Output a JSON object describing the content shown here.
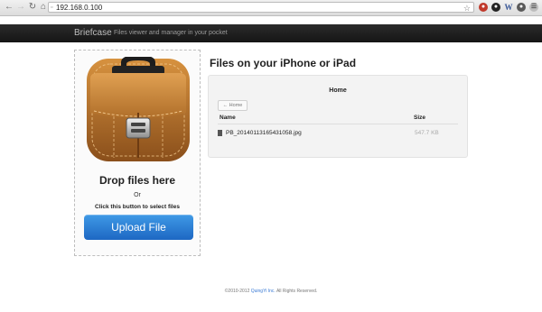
{
  "browser": {
    "url": "192.168.0.100",
    "back_icon": "back-arrow-icon",
    "forward_icon": "forward-arrow-icon",
    "reload_icon": "reload-icon",
    "home_icon": "home-icon",
    "bookmark_icon": "star-icon",
    "extensions": [
      {
        "icon": "adblock-icon",
        "glyph": "",
        "color": "#c0392b"
      },
      {
        "icon": "dark-globe-icon",
        "glyph": "",
        "color": "#222222"
      },
      {
        "icon": "wikipedia-icon",
        "glyph": "W",
        "color": "#3b5998"
      },
      {
        "icon": "circle-icon",
        "glyph": "",
        "color": "#5a5a5a"
      },
      {
        "icon": "settings-icon",
        "glyph": "",
        "color": "#9a9a9a"
      }
    ]
  },
  "header": {
    "brand": "Briefcase",
    "tagline": "Files viewer and manager in your pocket"
  },
  "upload": {
    "title": "Drop files here",
    "or": "Or",
    "instructions": "Click this button to select files",
    "button_label": "Upload File",
    "button_color": "#1d67c3"
  },
  "files": {
    "title": "Files on your iPhone or iPad",
    "current_folder": "Home",
    "home_button_label": "Home",
    "columns": {
      "name": "Name",
      "size": "Size"
    },
    "rows": [
      {
        "name": "PB_20140113165431058.jpg",
        "size": "547.7 KB",
        "icon": "file-icon"
      }
    ]
  },
  "footer": {
    "prefix": "©2010-2012",
    "company": "QuingYi Inc.",
    "suffix": "All Rights Reserved."
  }
}
